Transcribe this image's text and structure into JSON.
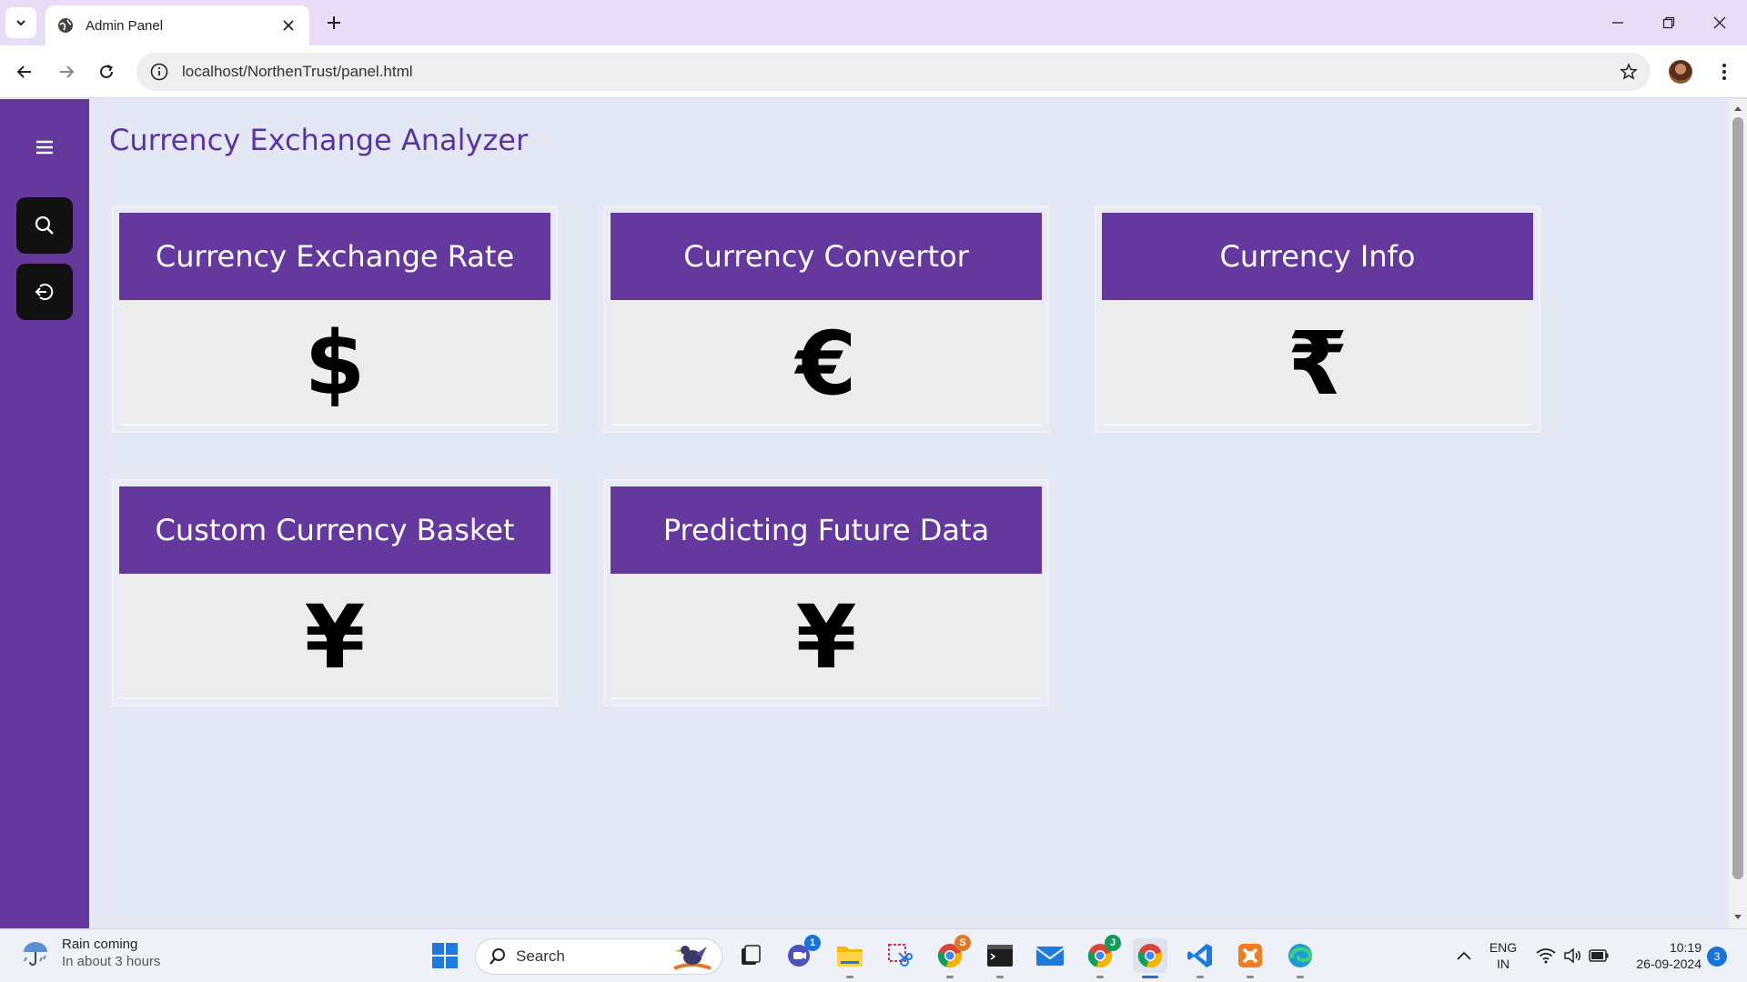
{
  "browser": {
    "tab_title": "Admin Panel",
    "url": "localhost/NorthenTrust/panel.html"
  },
  "page": {
    "heading": "Currency Exchange Analyzer",
    "cards": [
      {
        "title": "Currency Exchange Rate",
        "symbol": "$"
      },
      {
        "title": "Currency Convertor",
        "symbol": "€"
      },
      {
        "title": "Currency Info",
        "symbol": "₹"
      },
      {
        "title": "Custom Currency Basket",
        "symbol": "¥"
      },
      {
        "title": "Predicting Future Data",
        "symbol": "¥"
      }
    ]
  },
  "taskbar": {
    "weather_title": "Rain coming",
    "weather_sub": "In about 3 hours",
    "search_label": "Search",
    "teams_badge": "1",
    "chrome_badge": "S",
    "chrome_profile_badge": "J",
    "lang_top": "ENG",
    "lang_bottom": "IN",
    "time": "10:19",
    "date": "26-09-2024",
    "notifications": "3"
  },
  "colors": {
    "brand_purple": "#65389e",
    "page_bg": "#e4e8f4",
    "card_body": "#ececec"
  }
}
